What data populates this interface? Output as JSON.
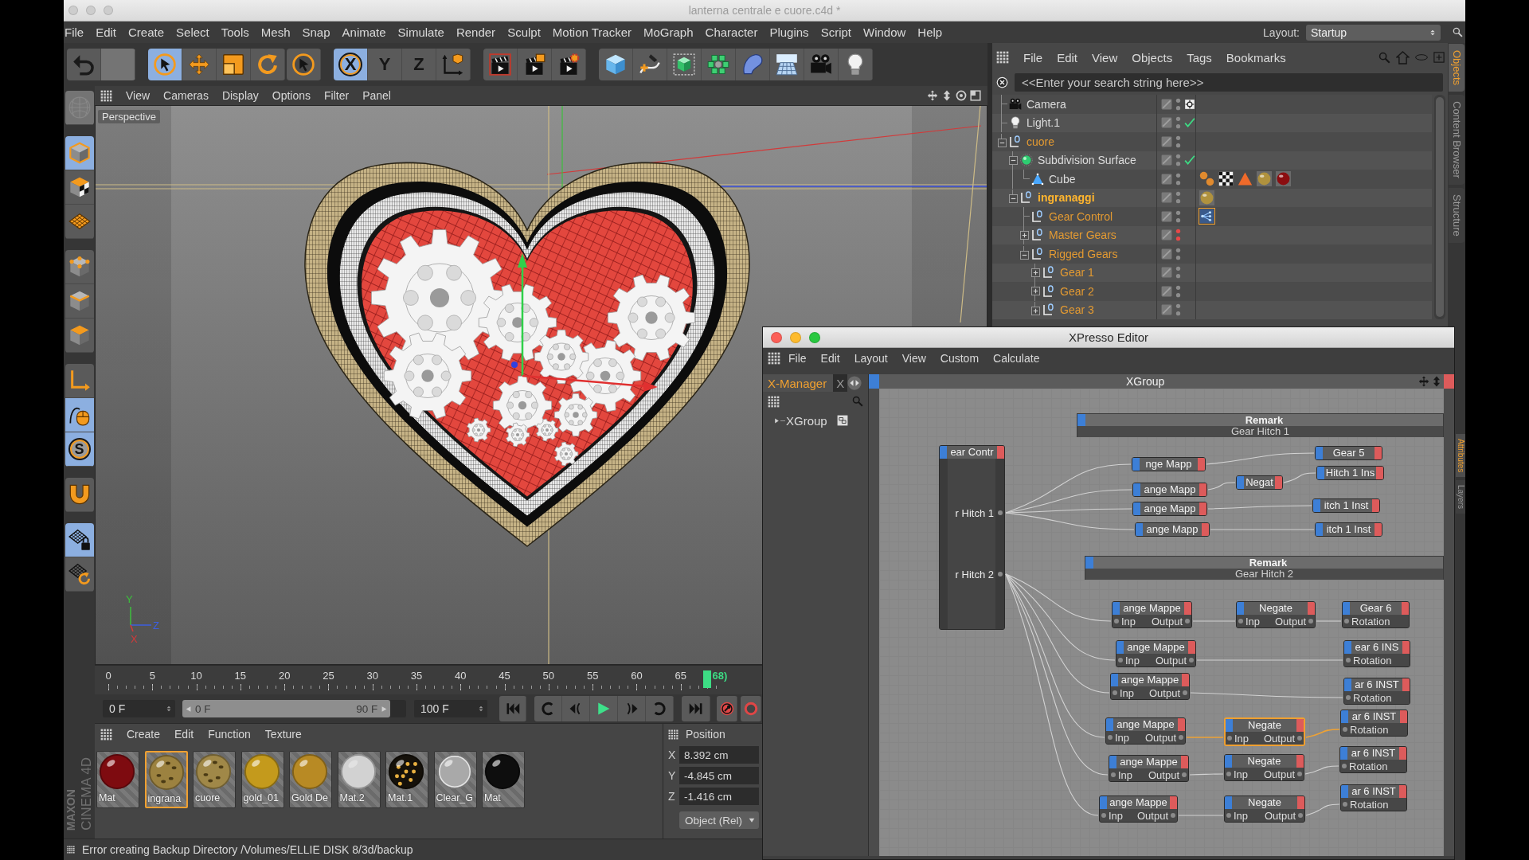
{
  "window": {
    "title": "lanterna centrale e cuore.c4d *",
    "focused": false
  },
  "menu": [
    "File",
    "Edit",
    "Create",
    "Select",
    "Tools",
    "Mesh",
    "Snap",
    "Animate",
    "Simulate",
    "Render",
    "Sculpt",
    "Motion Tracker",
    "MoGraph",
    "Character",
    "Plugins",
    "Script",
    "Window",
    "Help"
  ],
  "layout": {
    "label": "Layout:",
    "value": "Startup"
  },
  "toolbar": [
    {
      "buttons": [
        {
          "kind": "undo",
          "disabled": false
        },
        {
          "kind": "redo",
          "disabled": true
        }
      ]
    },
    {
      "buttons": [
        {
          "kind": "select",
          "selected": true
        },
        {
          "kind": "move",
          "selected": false
        },
        {
          "kind": "scale",
          "selected": false
        },
        {
          "kind": "rotate",
          "selected": false
        }
      ]
    },
    {
      "buttons": [
        {
          "kind": "live-select",
          "selected": false
        }
      ]
    },
    {
      "buttons": [
        {
          "kind": "axis",
          "label": "X",
          "selected": true
        },
        {
          "kind": "axis",
          "label": "Y",
          "selected": false
        },
        {
          "kind": "axis",
          "label": "Z",
          "selected": false
        },
        {
          "kind": "coord-system",
          "selected": false
        }
      ]
    },
    {
      "buttons": [
        {
          "kind": "render-view"
        },
        {
          "kind": "render-picture"
        },
        {
          "kind": "render-settings"
        }
      ]
    },
    {
      "buttons": [
        {
          "kind": "cube"
        },
        {
          "kind": "pen"
        },
        {
          "kind": "subdivision"
        },
        {
          "kind": "cloner"
        },
        {
          "kind": "deformer"
        },
        {
          "kind": "floor"
        },
        {
          "kind": "camera"
        },
        {
          "kind": "light"
        }
      ]
    }
  ],
  "tool_palette": [
    {
      "buttons": [
        {
          "kind": "sculpt",
          "selected": false,
          "disabled": true
        }
      ]
    },
    {
      "buttons": [
        {
          "kind": "model",
          "selected": true,
          "disabled": false
        },
        {
          "kind": "texture",
          "selected": false,
          "disabled": false
        },
        {
          "kind": "workplane",
          "selected": false,
          "disabled": false
        }
      ]
    },
    {
      "buttons": [
        {
          "kind": "points",
          "selected": false,
          "disabled": false
        },
        {
          "kind": "edges",
          "selected": false,
          "disabled": false
        },
        {
          "kind": "polygons",
          "selected": false,
          "disabled": false
        }
      ]
    },
    {
      "buttons": [
        {
          "kind": "axis-mode",
          "selected": false,
          "disabled": false
        },
        {
          "kind": "tweak",
          "selected": true,
          "disabled": false
        },
        {
          "kind": "snap",
          "label": "S",
          "selected": true,
          "disabled": false
        }
      ]
    },
    {
      "buttons": [
        {
          "kind": "magnet",
          "selected": false,
          "disabled": false
        }
      ]
    },
    {
      "buttons": [
        {
          "kind": "grid-lock",
          "selected": true,
          "disabled": false
        },
        {
          "kind": "grid-rotate",
          "selected": false,
          "disabled": false
        }
      ]
    }
  ],
  "viewport": {
    "menu": [
      "View",
      "Cameras",
      "Display",
      "Options",
      "Filter",
      "Panel"
    ],
    "camera": "Perspective",
    "axes": [
      {
        "label": "Y",
        "color": "#3cbf3c"
      },
      {
        "label": "Z",
        "color": "#3d5ee0"
      },
      {
        "label": "X",
        "color": "#d23a3a"
      }
    ]
  },
  "timeline": {
    "ticks": [
      "0",
      "5",
      "10",
      "15",
      "20",
      "25",
      "30",
      "35",
      "40",
      "45",
      "50",
      "55",
      "60",
      "65"
    ],
    "playhead": {
      "label": "68)",
      "level": 0.971
    }
  },
  "transport": {
    "start": "0 F",
    "range": {
      "start": "0 F",
      "end": "90 F",
      "level": 0.93
    },
    "end": "100 F",
    "groups": [
      {
        "buttons": [
          {
            "kind": "first"
          }
        ]
      },
      {
        "buttons": [
          {
            "kind": "prev-key"
          },
          {
            "kind": "prev-frame"
          },
          {
            "kind": "play"
          },
          {
            "kind": "next-frame"
          },
          {
            "kind": "next-key"
          }
        ]
      },
      {
        "buttons": [
          {
            "kind": "last"
          }
        ]
      },
      {
        "buttons": [
          {
            "kind": "record"
          }
        ]
      },
      {
        "buttons": [
          {
            "kind": "autokey"
          }
        ]
      }
    ]
  },
  "materials": {
    "menu": [
      "Create",
      "Edit",
      "Function",
      "Texture"
    ],
    "items": [
      {
        "name": "Mat",
        "kind": "glossy",
        "color": "#7e0b10",
        "selected": false
      },
      {
        "name": "ingrana",
        "kind": "bumpy",
        "color": "#9c8240",
        "selected": true
      },
      {
        "name": "cuore",
        "kind": "bumpy",
        "color": "#a08848",
        "selected": false
      },
      {
        "name": "gold_01",
        "kind": "glossy",
        "color": "#c49a1c",
        "selected": false
      },
      {
        "name": "Gold De",
        "kind": "glossy",
        "color": "#b88a24",
        "selected": false
      },
      {
        "name": "Mat.2",
        "kind": "matte",
        "color": "#d2d2d2",
        "selected": false
      },
      {
        "name": "Mat.1",
        "kind": "dotted",
        "color": "#15110a",
        "selected": false
      },
      {
        "name": "Clear_G",
        "kind": "glass",
        "color": "#a9a9a9",
        "selected": false
      },
      {
        "name": "Mat",
        "kind": "glossy",
        "color": "#0e0e0e",
        "selected": false
      }
    ]
  },
  "coordinates": {
    "title": "Position",
    "rows": [
      {
        "axis": "X",
        "value": "8.392 cm"
      },
      {
        "axis": "Y",
        "value": "-4.845 cm"
      },
      {
        "axis": "Z",
        "value": "-1.416 cm"
      }
    ],
    "mode": "Object (Rel)"
  },
  "brand": {
    "maker": "MAXON",
    "product": "CINEMA 4D"
  },
  "status_bar": "Error creating Backup Directory /Volumes/ELLIE DISK 8/3d/backup",
  "object_manager": {
    "menu": [
      "File",
      "Edit",
      "View",
      "Objects",
      "Tags",
      "Bookmarks"
    ],
    "search": {
      "placeholder": "<<Enter your search string here>>"
    },
    "objects": [
      {
        "name": "Camera",
        "kind": "camera",
        "selected": false,
        "active": false,
        "hidden": false
      },
      {
        "name": "Light.1",
        "kind": "light",
        "selected": false,
        "active": false,
        "hidden": false,
        "enabled": true
      },
      {
        "name": "cuore",
        "kind": "null",
        "selected": true,
        "active": false,
        "hidden": false,
        "expanded": true,
        "children": [
          {
            "name": "Subdivision Surface",
            "kind": "subdivision",
            "selected": false,
            "active": false,
            "hidden": false,
            "enabled": true,
            "expanded": true,
            "children": [
              {
                "name": "Cube",
                "kind": "polygon",
                "selected": false,
                "active": false,
                "hidden": false,
                "tags": [
                  {
                    "kind": "dots",
                    "selected": false
                  },
                  {
                    "kind": "checker",
                    "selected": false
                  },
                  {
                    "kind": "triangle",
                    "selected": false
                  },
                  {
                    "kind": "material",
                    "color": "#b0923e",
                    "selected": false
                  },
                  {
                    "kind": "material",
                    "color": "#8b0d10",
                    "selected": false
                  }
                ]
              }
            ]
          },
          {
            "name": "ingranaggi",
            "kind": "null",
            "selected": true,
            "active": true,
            "hidden": false,
            "expanded": true,
            "tags": [
              {
                "kind": "material",
                "color": "#b0923e",
                "selected": false
              }
            ],
            "children": [
              {
                "name": "Gear Control",
                "kind": "null",
                "selected": true,
                "active": false,
                "hidden": false,
                "tags": [
                  {
                    "kind": "xpresso",
                    "selected": true
                  }
                ]
              },
              {
                "name": "Master Gears",
                "kind": "null",
                "selected": true,
                "active": false,
                "hidden": true,
                "expanded": false
              },
              {
                "name": "Rigged Gears",
                "kind": "null",
                "selected": true,
                "active": false,
                "hidden": false,
                "expanded": true,
                "children": [
                  {
                    "name": "Gear 1",
                    "kind": "null",
                    "selected": true,
                    "active": false,
                    "hidden": false,
                    "expanded": false
                  },
                  {
                    "name": "Gear 2",
                    "kind": "null",
                    "selected": true,
                    "active": false,
                    "hidden": false,
                    "expanded": false
                  },
                  {
                    "name": "Gear 3",
                    "kind": "null",
                    "selected": true,
                    "active": false,
                    "hidden": false,
                    "expanded": false
                  }
                ]
              }
            ]
          }
        ]
      }
    ]
  },
  "side_tabs": [
    {
      "label": "Objects",
      "selected": true
    },
    {
      "label": "Content Browser",
      "selected": false
    },
    {
      "label": "Structure",
      "selected": false
    }
  ],
  "lower_tabs": [
    {
      "label": "Attributes",
      "selected": true
    },
    {
      "label": "Layers",
      "selected": false
    }
  ],
  "xpresso": {
    "title": "XPresso Editor",
    "focused": true,
    "menu": [
      "File",
      "Edit",
      "Layout",
      "View",
      "Custom",
      "Calculate"
    ],
    "tabs": [
      {
        "label": "X-Manager",
        "selected": true
      },
      {
        "label": "X",
        "selected": false
      }
    ],
    "tree": [
      {
        "name": "XGroup",
        "expanded": false
      }
    ],
    "graph": {
      "title": "XGroup",
      "remarks": [
        {
          "title": "Remark",
          "text": "Gear Hitch 1"
        },
        {
          "title": "Remark",
          "text": "Gear Hitch 2"
        }
      ],
      "nodes": [
        {
          "kind": "group",
          "title": "ear Contr",
          "ports": [
            "r Hitch 1",
            "r Hitch 2"
          ],
          "selected": false
        },
        {
          "kind": "node",
          "title": "nge Mapp",
          "selected": false
        },
        {
          "kind": "node",
          "title": "ange Mapp",
          "selected": false
        },
        {
          "kind": "node",
          "title": "Negat",
          "selected": false
        },
        {
          "kind": "node",
          "title": "ange Mapp",
          "selected": false
        },
        {
          "kind": "node",
          "title": "ange Mapp",
          "selected": false
        },
        {
          "kind": "node",
          "title": "Gear 5",
          "selected": false
        },
        {
          "kind": "node",
          "title": "Hitch 1 Ins",
          "selected": false
        },
        {
          "kind": "node",
          "title": "itch 1 Inst",
          "selected": false
        },
        {
          "kind": "node",
          "title": "itch 1 Inst",
          "selected": false
        },
        {
          "kind": "node",
          "title": "ange Mappe",
          "input": "Inp",
          "output": "Output",
          "selected": false
        },
        {
          "kind": "node",
          "title": "ange Mappe",
          "input": "Inp",
          "output": "Output",
          "selected": false
        },
        {
          "kind": "node",
          "title": "ange Mappe",
          "input": "Inp",
          "output": "Output",
          "selected": false
        },
        {
          "kind": "node",
          "title": "ange Mappe",
          "input": "Inp",
          "output": "Output",
          "selected": false
        },
        {
          "kind": "node",
          "title": "ange Mappe",
          "input": "Inp",
          "output": "Output",
          "selected": false
        },
        {
          "kind": "node",
          "title": "ange Mappe",
          "input": "Inp",
          "output": "Output",
          "selected": false
        },
        {
          "kind": "node",
          "title": "Negate",
          "input": "Inp",
          "output": "Output",
          "selected": false
        },
        {
          "kind": "node",
          "title": "Negate",
          "input": "Inp",
          "output": "Output",
          "selected": true
        },
        {
          "kind": "node",
          "title": "Negate",
          "input": "Inp",
          "output": "Output",
          "selected": false
        },
        {
          "kind": "node",
          "title": "Negate",
          "input": "Inp",
          "output": "Output",
          "selected": false
        },
        {
          "kind": "node",
          "title": "Gear 6",
          "input": "Rotation",
          "selected": false
        },
        {
          "kind": "node",
          "title": "ear 6 INS",
          "input": "Rotation",
          "selected": false
        },
        {
          "kind": "node",
          "title": "ar 6 INST",
          "input": "Rotation",
          "selected": false
        },
        {
          "kind": "node",
          "title": "ar 6 INST",
          "input": "Rotation",
          "selected": false
        },
        {
          "kind": "node",
          "title": "ar 6 INST",
          "input": "Rotation",
          "selected": false
        },
        {
          "kind": "node",
          "title": "ar 6 INST",
          "input": "Rotation",
          "selected": false
        }
      ]
    }
  }
}
